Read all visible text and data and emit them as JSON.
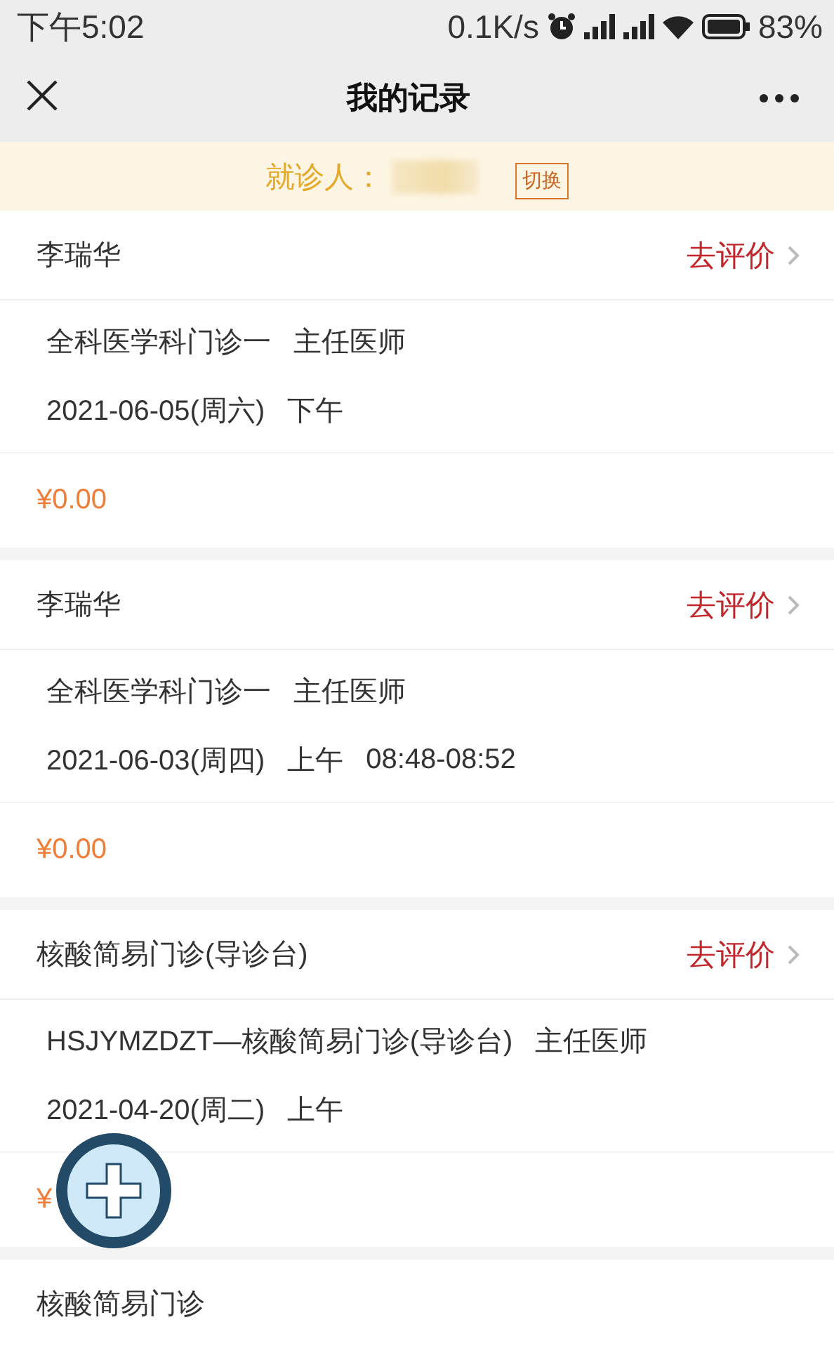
{
  "status_bar": {
    "time": "下午5:02",
    "net_speed": "0.1K/s",
    "battery": "83%"
  },
  "nav": {
    "title": "我的记录"
  },
  "patient": {
    "label": "就诊人：",
    "switch": "切换"
  },
  "records": [
    {
      "title": "李瑞华",
      "action": "去评价",
      "department": "全科医学科门诊一",
      "doctor": "主任医师",
      "date": "2021-06-05(周六)",
      "period": "下午",
      "price": "¥0.00"
    },
    {
      "title": "李瑞华",
      "action": "去评价",
      "department": "全科医学科门诊一",
      "doctor": "主任医师",
      "date": "2021-06-03(周四)",
      "period": "上午",
      "time": "08:48-08:52",
      "price": "¥0.00"
    },
    {
      "title": "核酸简易门诊(导诊台)",
      "action": "去评价",
      "department": "HSJYMZDZT—核酸简易门诊(导诊台)",
      "doctor": "主任医师",
      "date": "2021-04-20(周二)",
      "period": "上午",
      "price": "¥"
    },
    {
      "title": "核酸简易门诊"
    }
  ]
}
